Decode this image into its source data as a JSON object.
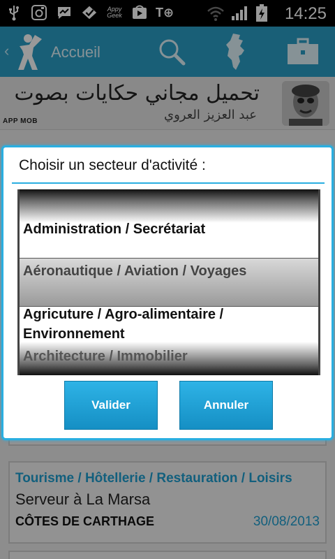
{
  "status_bar": {
    "time": "14:25",
    "left_icons": [
      "usb-icon",
      "instagram-icon",
      "messenger-icon",
      "check-icon",
      "appy-geek-icon",
      "play-store-icon",
      "text-plus-icon"
    ],
    "right_icons": [
      "wifi-icon",
      "signal-icon",
      "battery-charging-icon"
    ],
    "appy_geek_label": "Appy\nGeek"
  },
  "action_bar": {
    "title": "Accueil",
    "back_glyph": "‹",
    "icons": [
      "app-logo-icon",
      "search-icon",
      "tunisia-map-icon",
      "briefcase-icon"
    ]
  },
  "banner": {
    "arabic_title": "تحميل مجاني حكايات بصوت",
    "arabic_sub": "عبد العزيز العروي",
    "appmob_label": "APP MOB"
  },
  "dialog": {
    "title": "Choisir un secteur d'activité :",
    "options": [
      {
        "label": "Administration / Secrétariat",
        "selected": false,
        "style": "bold"
      },
      {
        "label": "Aéronautique / Aviation / Voyages",
        "selected": true,
        "style": "muted"
      },
      {
        "label_line1": "Agricuture / Agro-alimentaire /",
        "label_line2": "Environnement",
        "selected": false,
        "style": "bold"
      },
      {
        "label": "Architecture / Immobilier",
        "selected": false,
        "style": "muted"
      }
    ],
    "confirm_label": "Valider",
    "cancel_label": "Annuler"
  },
  "job_listing": {
    "sector": "Tourisme / Hôtellerie / Restauration / Loisirs",
    "job_title": "Serveur à La Marsa",
    "company": "CÔTES DE CARTHAGE",
    "date": "30/08/2013"
  },
  "colors": {
    "accent": "#2b9fc7",
    "dialog_border": "#2aaee0",
    "link": "#1e9fd0",
    "button": "#1ea2d8"
  }
}
